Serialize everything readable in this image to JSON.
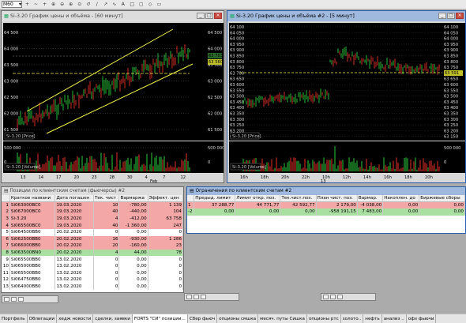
{
  "toolbar": {
    "timeframe": "M60",
    "items": [
      "+",
      "~",
      "+",
      "⊕",
      "⊖",
      "⊕",
      "⊙",
      "↺",
      "/",
      "↗",
      "∿",
      "A",
      "□",
      "▢",
      "◇",
      "▭"
    ]
  },
  "win1": {
    "title": "Si-3.20 График цены и объёма - [60 минут]",
    "price_label": "Si-3.20 [Price]",
    "volume_label": "Si-3.20 [Volume]",
    "left_ticks": [
      "64 500",
      "64 000",
      "63 500",
      "63 000",
      "62 500",
      "62 000",
      "61 500"
    ],
    "right_ticks": [
      "64 500",
      "64 000",
      "63 500",
      "63 000",
      "62 500",
      "62 000",
      "61 500"
    ],
    "right_price_boxes": [
      "63 703",
      "63 560"
    ],
    "vol_ticks": [
      "500 000",
      "0"
    ],
    "x_ticks": [
      "13",
      "14",
      "17",
      "20",
      "23",
      "28",
      "30",
      "4",
      "7",
      "12"
    ],
    "x_sub": "Feb"
  },
  "win2": {
    "title": "Si-3.20 График цены и объёма #2 - [5 минут]",
    "price_label": "Si-3.20 [Price]",
    "volume_label": "Si-3.20 [Volume]",
    "ticks": [
      "64 100",
      "64 050",
      "64 000",
      "63 950",
      "63 900",
      "63 850",
      "63 800",
      "63 750",
      "63 700",
      "63 650",
      "63 600",
      "63 550",
      "63 500",
      "63 450",
      "63 400",
      "63 350",
      "63 300",
      "63 250",
      "63 200",
      "63 150"
    ],
    "last_price": "63 591",
    "vol_ticks": [
      "500 000",
      "0"
    ],
    "x_ticks": [
      "16h",
      "18h",
      "20h",
      "22h",
      "10h",
      "12h",
      "14h",
      "16h",
      "18h",
      "20h"
    ],
    "x_sub": "13"
  },
  "positions": {
    "title": "Позиции по клиентским счетам (фьючерсы) #2",
    "columns": [
      "",
      "Краткое названи",
      "Дата погашен",
      "Тек. чист",
      "Вармаржа",
      "Эффект. цен"
    ],
    "rows": [
      {
        "n": "1",
        "name": "Si063000BC0",
        "date": "19.03.2020",
        "qty": "10",
        "var": "-780,00",
        "price": "1 139",
        "style": "red"
      },
      {
        "n": "2",
        "name": "Si067000BC0",
        "date": "19.03.2020",
        "qty": "40",
        "var": "-440,00",
        "price": "104",
        "style": "red"
      },
      {
        "n": "3",
        "name": "Si-3.20",
        "date": "19.03.2020",
        "qty": "4",
        "var": "-412,00",
        "price": "63 758",
        "style": "red"
      },
      {
        "n": "4",
        "name": "Si065500BC0",
        "date": "19.03.2020",
        "qty": "40",
        "var": "-1 360,00",
        "price": "247",
        "style": "red"
      },
      {
        "n": "5",
        "name": "Si064500BB0",
        "date": "20.02.2020",
        "qty": "0",
        "var": "0,00",
        "price": "0",
        "style": "white"
      },
      {
        "n": "6",
        "name": "Si062500BB0",
        "date": "20.02.2020",
        "qty": "16",
        "var": "-930,00",
        "price": "1 286",
        "style": "red"
      },
      {
        "n": "7",
        "name": "Si066000BB0",
        "date": "20.02.2020",
        "qty": "20",
        "var": "-160,00",
        "price": "23",
        "style": "red"
      },
      {
        "n": "8",
        "name": "Si063500BN0",
        "date": "20.02.2020",
        "qty": "4",
        "var": "44,00",
        "price": "78",
        "style": "green"
      },
      {
        "n": "9",
        "name": "Si065500BB0",
        "date": "13.02.2020",
        "qty": "0",
        "var": "0,00",
        "price": "0",
        "style": "white"
      },
      {
        "n": "10",
        "name": "Si065000BB0",
        "date": "13.02.2020",
        "qty": "0",
        "var": "0,00",
        "price": "0",
        "style": "white"
      },
      {
        "n": "11",
        "name": "Si065500BB0",
        "date": "13.02.2020",
        "qty": "0",
        "var": "0,00",
        "price": "0",
        "style": "white"
      },
      {
        "n": "12",
        "name": "Si064750BB0",
        "date": "13.02.2020",
        "qty": "0",
        "var": "0,00",
        "price": "0",
        "style": "white"
      },
      {
        "n": "13",
        "name": "Si064000BB0",
        "date": "13.02.2020",
        "qty": "0",
        "var": "0,00",
        "price": "0",
        "style": "white"
      }
    ]
  },
  "limits": {
    "title": "Ограничения по клиентским счетам #2",
    "columns": [
      "",
      "Предыд. лимит",
      "Лимит откр. поз.",
      "Тек.чист.поз.",
      "План чист. поз.",
      "Вармар.",
      "Накоплен. до",
      "Биржевые сборы"
    ],
    "rows": [
      {
        "n": "1",
        "a": "37 288,77",
        "b": "44 771,77",
        "c": "42 592,77",
        "d": "2 179,00",
        "e": "-4 038,00",
        "f": "0,00",
        "g": "0,00",
        "style": "red"
      },
      {
        "n": "-2",
        "a": "0,00",
        "b": "0,00",
        "c": "0,00",
        "d": "-958 191,15",
        "e": "7 483,00",
        "f": "0,00",
        "g": "0,00",
        "style": "green"
      }
    ]
  },
  "taskbar": [
    "Портфель",
    "Облигации",
    "хедж новости",
    "сделки, заявки",
    "FORTS \"СИ\" позиции...",
    "Сбер фьюч",
    "опционы смшка",
    "месяч. путы Сишка",
    "опционы ртс",
    "золото..",
    "нефть",
    "анализ ..",
    "офз фьючи"
  ]
}
